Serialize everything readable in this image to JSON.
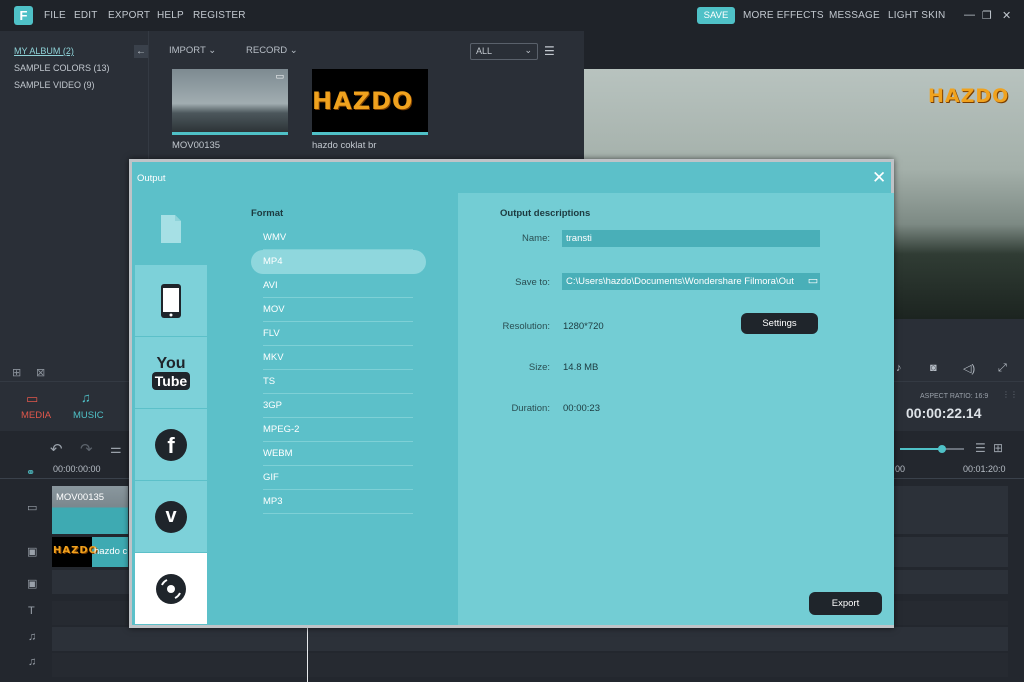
{
  "menu": {
    "logo": "F",
    "items": [
      "FILE",
      "EDIT",
      "EXPORT",
      "HELP",
      "REGISTER"
    ],
    "save_label": "SAVE",
    "right_items": [
      "MORE EFFECTS",
      "MESSAGE",
      "LIGHT SKIN"
    ]
  },
  "library": {
    "albums": [
      "MY ALBUM (2)",
      "SAMPLE COLORS (13)",
      "SAMPLE VIDEO (9)"
    ],
    "import_label": "IMPORT",
    "record_label": "RECORD",
    "filter_value": "ALL",
    "items": [
      {
        "label": "MOV00135",
        "icon": "video-camera-icon"
      },
      {
        "label": "hazdo coklat br",
        "logo_text": "HAZDO"
      }
    ]
  },
  "preview": {
    "watermark": "HAZDO",
    "aspect_ratio": "ASPECT RATIO: 16:9",
    "time": "00:00:22.14"
  },
  "tabs": [
    {
      "label": "MEDIA",
      "icon": "folder-icon",
      "active": true
    },
    {
      "label": "MUSIC",
      "icon": "music-note-icon",
      "active": false
    }
  ],
  "timeline": {
    "ruler_start": "00:00:00:00",
    "ruler_end": "00:01:20:0",
    "ruler_mid": "00",
    "clips": [
      "MOV00135",
      "hazdo c"
    ]
  },
  "dialog": {
    "title": "Output",
    "nav": [
      {
        "name": "file-icon"
      },
      {
        "name": "phone-icon"
      },
      {
        "name": "youtube-icon",
        "text": "You Tube"
      },
      {
        "name": "facebook-icon",
        "text": "f"
      },
      {
        "name": "vimeo-icon",
        "text": "v"
      },
      {
        "name": "disc-icon"
      }
    ],
    "format_title": "Format",
    "formats": [
      "WMV",
      "MP4",
      "AVI",
      "MOV",
      "FLV",
      "MKV",
      "TS",
      "3GP",
      "MPEG-2",
      "WEBM",
      "GIF",
      "MP3"
    ],
    "selected_format": "MP4",
    "desc_title": "Output descriptions",
    "name_label": "Name:",
    "name_value": "transti",
    "saveto_label": "Save to:",
    "saveto_value": "C:\\Users\\hazdo\\Documents\\Wondershare Filmora\\Out",
    "resolution_label": "Resolution:",
    "resolution_value": "1280*720",
    "settings_label": "Settings",
    "size_label": "Size:",
    "size_value": "14.8 MB",
    "duration_label": "Duration:",
    "duration_value": "00:00:23",
    "export_label": "Export"
  },
  "colors": {
    "accent": "#4fc1c7",
    "dialog_bg": "#5cc0c9",
    "desc_bg": "#73cdd4",
    "dark": "#2a2f37"
  }
}
